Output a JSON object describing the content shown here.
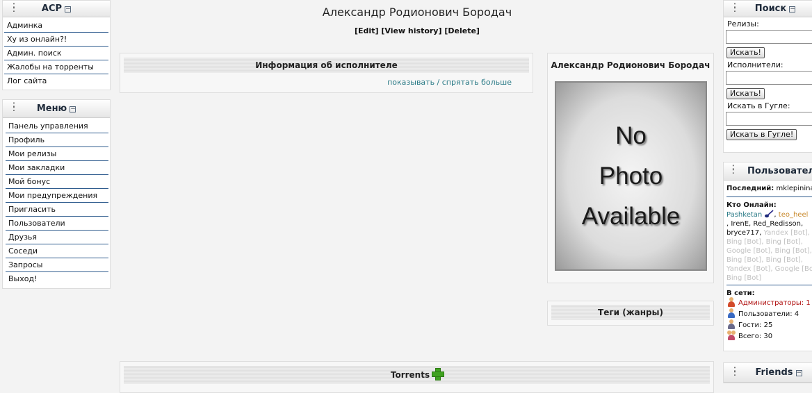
{
  "acp": {
    "title": "ACP",
    "items": [
      "Админка",
      "Ху из онлайн?!",
      "Админ. поиск",
      "Жалобы на торренты",
      "Лог сайта"
    ]
  },
  "menu": {
    "title": "Меню",
    "items": [
      "Панель управления",
      "Профиль",
      "Мои релизы",
      "Мои закладки",
      "Мой бонус",
      "Мои предупреждения",
      "Пригласить",
      "Пользователи",
      "Друзья",
      "Соседи",
      "Запросы",
      "Выход!"
    ]
  },
  "page": {
    "title": "Александр Родионович Бородач",
    "edit": "[Edit]",
    "history": "[View history]",
    "delete": "[Delete]"
  },
  "info": {
    "title": "Информация об исполнителе",
    "toggle": "показывать / спрятать больше"
  },
  "artist": {
    "name": "Александр Родионович Бородач",
    "photo_lines": [
      "No",
      "Photo",
      "Available"
    ]
  },
  "tags": {
    "title": "Теги (жанры)"
  },
  "torrents": {
    "title": "Torrents"
  },
  "search": {
    "title": "Поиск",
    "releases_label": "Релизы:",
    "artists_label": "Исполнители:",
    "google_label": "Искать в Гугле:",
    "search_btn": "Искать!",
    "google_btn": "Искать в Гугле!"
  },
  "users": {
    "title": "Пользователи",
    "last_label": "Последний:",
    "last_user": "mklepinina",
    "online_label": "Кто Онлайн:",
    "online_user1": "Pashketan",
    "online_sep1": ", ",
    "online_user2": "teo_heel",
    "online_rest_1": ", IrenE, Red_Redisson,",
    "online_rest_2": "bryce717,",
    "bot_1": " Yandex [Bot],",
    "bot_2": "Bing [Bot], Bing [Bot],",
    "bot_3": "Google [Bot], Bing [Bot],",
    "bot_4": "Bing [Bot], Bing [Bot],",
    "bot_5": "Yandex [Bot], Google [Bot]",
    "bot_6": "Bing [Bot]",
    "net_label": "В сети:",
    "admins": "Администраторы: 1",
    "members": "Пользователи: 4",
    "guests": "Гости: 25",
    "total": "Всего: 30"
  },
  "friends": {
    "title": "Friends"
  },
  "colors": {
    "menu_border": "#2f5c8e",
    "link": "#2a7a86",
    "admin": "#b01010",
    "bot": "#c2c2c2"
  }
}
